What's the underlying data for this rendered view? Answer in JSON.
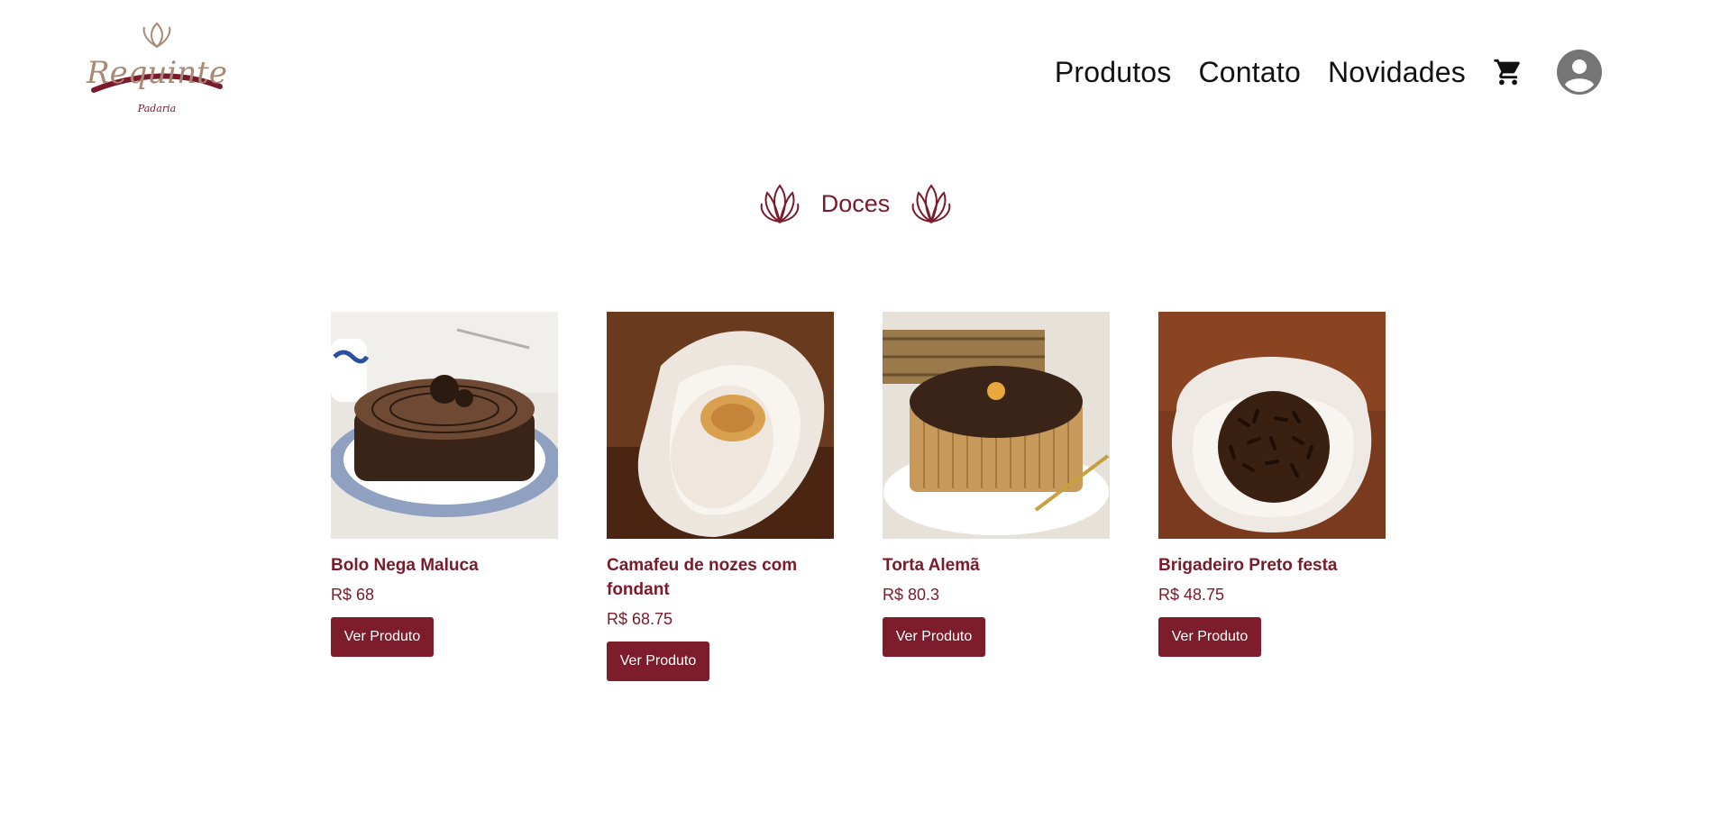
{
  "brand": {
    "logo_text": "Requinte",
    "logo_subtitle": "Padaria"
  },
  "nav": {
    "items": [
      "Produtos",
      "Contato",
      "Novidades"
    ],
    "cart_icon": "shopping-cart-icon",
    "avatar_icon": "user-avatar-icon"
  },
  "section": {
    "title": "Doces"
  },
  "products": [
    {
      "name": "Bolo Nega Maluca",
      "price": "R$ 68",
      "button": "Ver Produto"
    },
    {
      "name": "Camafeu de nozes com fondant",
      "price": "R$ 68.75",
      "button": "Ver Produto"
    },
    {
      "name": "Torta Alemã",
      "price": "R$ 80.3",
      "button": "Ver Produto"
    },
    {
      "name": "Brigadeiro Preto festa",
      "price": "R$ 48.75",
      "button": "Ver Produto"
    }
  ],
  "colors": {
    "accent": "#7a1a2a",
    "button": "#7d1d2c"
  }
}
